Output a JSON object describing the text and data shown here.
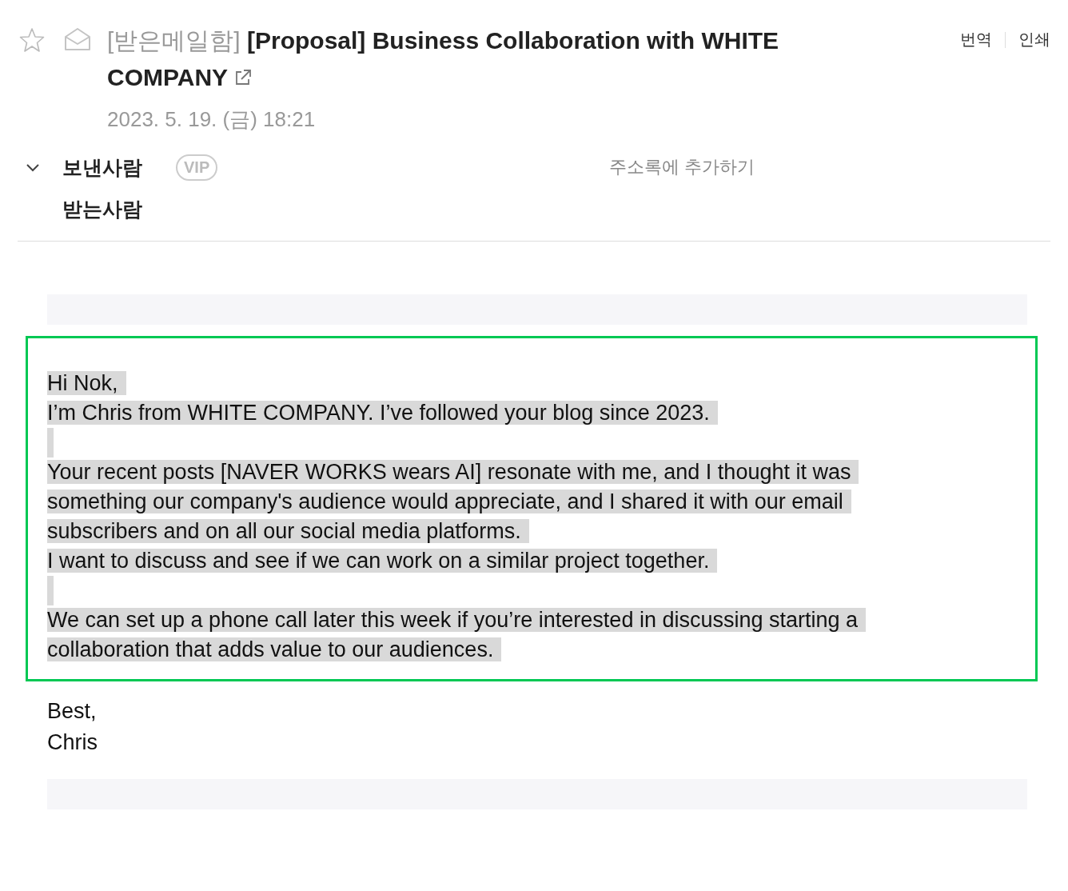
{
  "header": {
    "starred": false,
    "folder": "[받은메일함]",
    "subject": "[Proposal] Business Collaboration with WHITE COMPANY",
    "date": "2023. 5. 19. (금) 18:21",
    "actions": [
      "번역",
      "인쇄"
    ]
  },
  "people": {
    "expanded": false,
    "sender_label": "보낸사람",
    "vip": "VIP",
    "add_contact": "주소록에 추가하기",
    "recipient_label": "받는사람"
  },
  "body": {
    "lines": [
      {
        "kind": "text",
        "text": "Hi Nok,",
        "highlighted": true
      },
      {
        "kind": "text",
        "text": "I’m Chris from WHITE COMPANY. I’ve followed your blog since 2023.",
        "highlighted": true
      },
      {
        "kind": "blank",
        "highlighted": true
      },
      {
        "kind": "text",
        "text": "Your recent posts [NAVER WORKS wears AI] resonate with me, and I thought it was",
        "highlighted": true
      },
      {
        "kind": "text",
        "text": "something our company's audience would appreciate, and I shared it with our email",
        "highlighted": true
      },
      {
        "kind": "text",
        "text": "subscribers and on all our social media platforms.",
        "highlighted": true
      },
      {
        "kind": "text",
        "text": "I want to discuss and see if we can work on a similar project together.",
        "highlighted": true
      },
      {
        "kind": "blank",
        "highlighted": true
      },
      {
        "kind": "text",
        "text": "We can set up a phone call later this week if you’re interested in discussing starting a",
        "highlighted": true
      },
      {
        "kind": "text",
        "text": "collaboration that adds value to our audiences.",
        "highlighted": true
      }
    ],
    "closing": [
      {
        "kind": "text",
        "text": "Best,",
        "highlighted": false
      },
      {
        "kind": "text",
        "text": "Chris",
        "highlighted": false
      }
    ]
  }
}
